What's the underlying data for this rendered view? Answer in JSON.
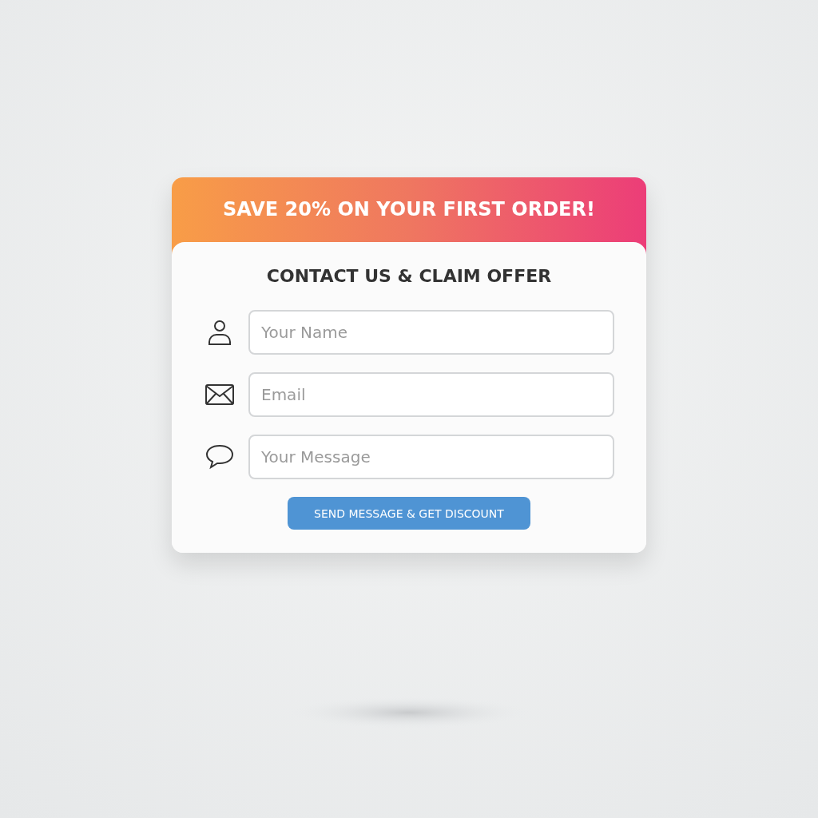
{
  "banner": {
    "text": "SAVE 20% ON YOUR FIRST ORDER!"
  },
  "form": {
    "title": "CONTACT US & CLAIM OFFER",
    "fields": [
      {
        "kind": "person",
        "placeholder": "Your Name"
      },
      {
        "kind": "email",
        "placeholder": "Email"
      },
      {
        "kind": "message",
        "placeholder": "Your Message"
      }
    ],
    "submit_button": "SEND MESSAGE & GET DISCOUNT"
  }
}
